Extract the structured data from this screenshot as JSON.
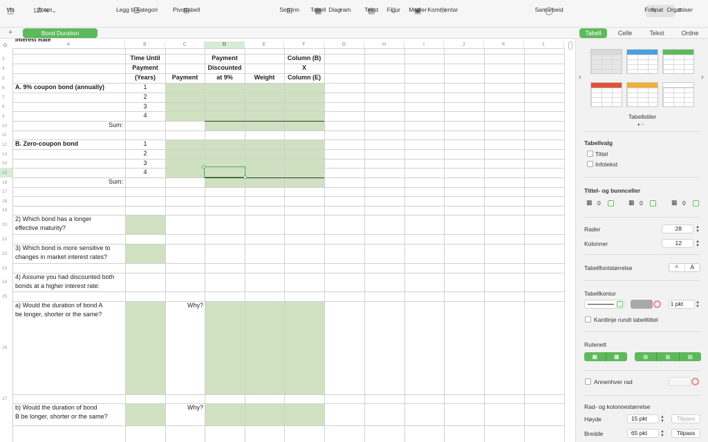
{
  "toolbar": {
    "zoom_value": "125 %",
    "items": {
      "view": "Vis",
      "zoom": "Zoom",
      "category": "Legg til kategori",
      "pivot": "Pivottabell",
      "insert": "Sett inn",
      "table": "Tabell",
      "chart": "Diagram",
      "text": "Tekst",
      "shape": "Figur",
      "media": "Medier",
      "comment": "Kommentar",
      "collab": "Samarbeid",
      "format": "Format",
      "organize": "Organiser"
    }
  },
  "sheet_tab": "Bond Duration",
  "inspector_tabs": [
    "Tabell",
    "Celle",
    "Tekst",
    "Ordne"
  ],
  "columns": [
    "A",
    "B",
    "C",
    "D",
    "E",
    "F",
    "G",
    "H",
    "I",
    "J",
    "K",
    "L"
  ],
  "rows": [
    "3",
    "4",
    "5",
    "6",
    "7",
    "8",
    "9",
    "10",
    "11",
    "12",
    "13",
    "14",
    "15",
    "16",
    "17",
    "18",
    "19",
    "20",
    "21",
    "22",
    "23",
    "24",
    "25",
    "26",
    "27",
    "28"
  ],
  "top_clip_text": "Interest Rate",
  "cells": {
    "b3": "Time Until",
    "b4": "Payment",
    "b5": "(Years)",
    "c5": "Payment",
    "d3": "Payment",
    "d4": "Discounted",
    "d5": "at 9%",
    "e5": "Weight",
    "f3": "Column (B)",
    "f4": "X",
    "f5": "Column (E)",
    "a6": "A. 9% coupon bond (annually)",
    "b6": "1",
    "b7": "2",
    "b8": "3",
    "b9": "4",
    "a10": "Sum:",
    "a12": "B. Zero-coupon bond",
    "b12": "1",
    "b13": "2",
    "b14": "3",
    "b15": "4",
    "a16": "Sum:",
    "q2a": "2) Which bond has a longer",
    "q2b": "effective maturity?",
    "q3a": "3) Which bond is more sensitive to",
    "q3b": "changes in market interest rates?",
    "q4a": "4) Assume you had discounted both",
    "q4b": "bonds at a higher interest rate:",
    "qaa": "a) Would the duration of bond A",
    "qab": "be longer, shorter or the same?",
    "why1": "Why?",
    "qba": "b) Would the duration of bond",
    "qbb": "B be longer, shorter or the same?",
    "why2": "Why?"
  },
  "inspector": {
    "styles_title": "Tabellstiler",
    "options_title": "Tabellvalg",
    "opt_title": "Tittel",
    "opt_caption": "Infotekst",
    "headers_title": "Tittel- og bunnceller",
    "header_rows": "0",
    "header_cols": "0",
    "footer_rows": "0",
    "rows_label": "Rader",
    "rows_value": "28",
    "cols_label": "Kolonner",
    "cols_value": "12",
    "fontsize_label": "Tabellfontstørrelse",
    "font_small": "A",
    "font_large": "A",
    "outline_label": "Tabellkontur",
    "outline_value": "1 pkt",
    "outline_title_label": "Kantlinje rundt tabelltittel",
    "grid_label": "Rutenett",
    "alt_row_label": "Annenhver rad",
    "size_title": "Rad- og kolonnestørrelse",
    "height_label": "Høyde",
    "height_value": "15 pkt",
    "width_label": "Bredde",
    "width_value": "65 pkt",
    "fit_label": "Tilpass",
    "fit_label2": "Tilpass",
    "style_colors": [
      "#d9d9d9",
      "#4a9fe0",
      "#5db95b",
      "#e0533a",
      "#eeb13a",
      "#ffffff"
    ]
  }
}
